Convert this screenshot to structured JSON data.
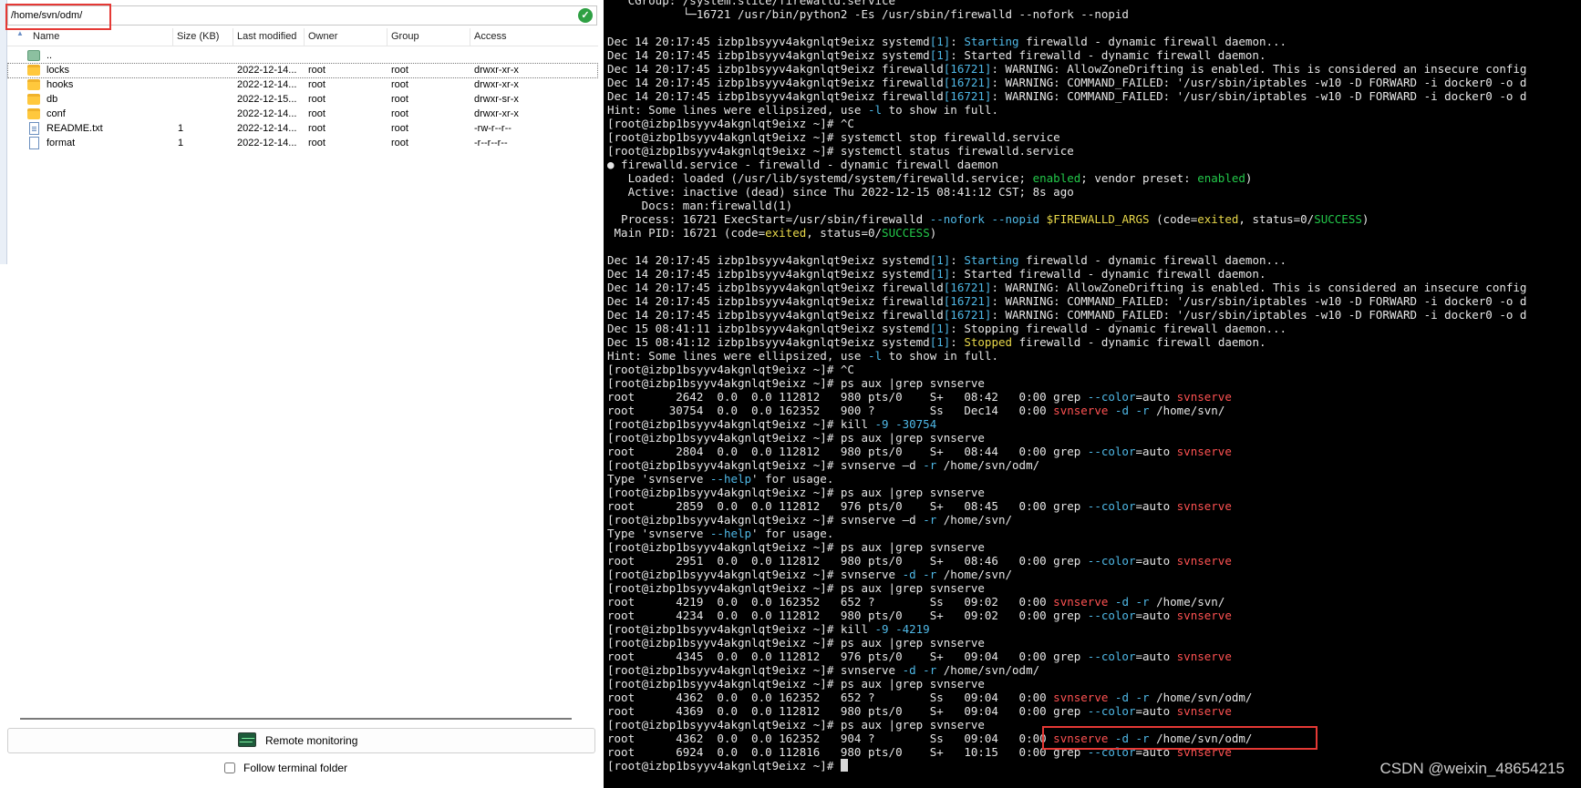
{
  "file_manager": {
    "path": "/home/svn/odm/",
    "columns": [
      "Name",
      "Size (KB)",
      "Last modified",
      "Owner",
      "Group",
      "Access"
    ],
    "rows": [
      {
        "icon": "parent-folder-icon",
        "name": "..",
        "size": "",
        "modified": "",
        "owner": "",
        "group": "",
        "access": ""
      },
      {
        "icon": "folder-icon",
        "name": "locks",
        "size": "",
        "modified": "2022-12-14...",
        "owner": "root",
        "group": "root",
        "access": "drwxr-xr-x"
      },
      {
        "icon": "folder-icon",
        "name": "hooks",
        "size": "",
        "modified": "2022-12-14...",
        "owner": "root",
        "group": "root",
        "access": "drwxr-xr-x"
      },
      {
        "icon": "folder-icon",
        "name": "db",
        "size": "",
        "modified": "2022-12-15...",
        "owner": "root",
        "group": "root",
        "access": "drwxr-sr-x"
      },
      {
        "icon": "folder-icon",
        "name": "conf",
        "size": "",
        "modified": "2022-12-14...",
        "owner": "root",
        "group": "root",
        "access": "drwxr-xr-x"
      },
      {
        "icon": "text-file-icon",
        "name": "README.txt",
        "size": "1",
        "modified": "2022-12-14...",
        "owner": "root",
        "group": "root",
        "access": "-rw-r--r--"
      },
      {
        "icon": "file-icon",
        "name": "format",
        "size": "1",
        "modified": "2022-12-14...",
        "owner": "root",
        "group": "root",
        "access": "-r--r--r--"
      }
    ],
    "remote_monitoring_label": "Remote monitoring",
    "follow_terminal_label": "Follow terminal folder"
  },
  "terminal": {
    "lines": [
      [
        [
          "   CGroup: /system.slice/firewalld.service",
          ""
        ]
      ],
      [
        [
          "           └─16721 /usr/bin/python2 -Es /usr/sbin/firewalld --nofork --nopid",
          ""
        ]
      ],
      [
        [
          "",
          ""
        ]
      ],
      [
        [
          "Dec 14 20:17:45 izbp1bsyyv4akgnlqt9eixz systemd",
          ""
        ],
        [
          "[1]",
          "blue"
        ],
        [
          ": ",
          ""
        ],
        [
          "Starting",
          "blue"
        ],
        [
          " firewalld - dynamic firewall daemon...",
          ""
        ]
      ],
      [
        [
          "Dec 14 20:17:45 izbp1bsyyv4akgnlqt9eixz systemd",
          ""
        ],
        [
          "[1]",
          "blue"
        ],
        [
          ": Started firewalld - dynamic firewall daemon.",
          ""
        ]
      ],
      [
        [
          "Dec 14 20:17:45 izbp1bsyyv4akgnlqt9eixz firewalld",
          ""
        ],
        [
          "[16721]",
          "blue"
        ],
        [
          ": WARNING: AllowZoneDrifting is enabled. This is considered an insecure config",
          ""
        ]
      ],
      [
        [
          "Dec 14 20:17:45 izbp1bsyyv4akgnlqt9eixz firewalld",
          ""
        ],
        [
          "[16721]",
          "blue"
        ],
        [
          ": WARNING: COMMAND_FAILED: '/usr/sbin/iptables -w10 -D FORWARD -i docker0 -o d",
          ""
        ]
      ],
      [
        [
          "Dec 14 20:17:45 izbp1bsyyv4akgnlqt9eixz firewalld",
          ""
        ],
        [
          "[16721]",
          "blue"
        ],
        [
          ": WARNING: COMMAND_FAILED: '/usr/sbin/iptables -w10 -D FORWARD -i docker0 -o d",
          ""
        ]
      ],
      [
        [
          "Hint: Some lines were ellipsized, use ",
          ""
        ],
        [
          "-l",
          "blue"
        ],
        [
          " to show in full.",
          ""
        ]
      ],
      [
        [
          "[root@izbp1bsyyv4akgnlqt9eixz ~]# ^C",
          ""
        ]
      ],
      [
        [
          "[root@izbp1bsyyv4akgnlqt9eixz ~]# systemctl stop firewalld.service",
          ""
        ]
      ],
      [
        [
          "[root@izbp1bsyyv4akgnlqt9eixz ~]# systemctl status firewalld.service",
          ""
        ]
      ],
      [
        [
          "● firewalld.service - firewalld - dynamic firewall daemon",
          ""
        ]
      ],
      [
        [
          "   Loaded: loaded (/usr/lib/systemd/system/firewalld.service; ",
          ""
        ],
        [
          "enabled",
          "green"
        ],
        [
          "; vendor preset: ",
          ""
        ],
        [
          "enabled",
          "green"
        ],
        [
          ")",
          ""
        ]
      ],
      [
        [
          "   Active: inactive (dead) since Thu 2022-12-15 08:41:12 CST; 8s ago",
          ""
        ]
      ],
      [
        [
          "     Docs: man:firewalld(1)",
          ""
        ]
      ],
      [
        [
          "  Process: 16721 ExecStart=/usr/sbin/firewalld ",
          ""
        ],
        [
          "--nofork --nopid",
          "blue"
        ],
        [
          " ",
          ""
        ],
        [
          "$FIREWALLD_ARGS",
          "yellow"
        ],
        [
          " (code=",
          ""
        ],
        [
          "exited",
          "yellow"
        ],
        [
          ", status=0/",
          ""
        ],
        [
          "SUCCESS",
          "green"
        ],
        [
          ")",
          ""
        ]
      ],
      [
        [
          " Main PID: 16721 (code=",
          ""
        ],
        [
          "exited",
          "yellow"
        ],
        [
          ", status=0/",
          ""
        ],
        [
          "SUCCESS",
          "green"
        ],
        [
          ")",
          ""
        ]
      ],
      [
        [
          "",
          ""
        ]
      ],
      [
        [
          "Dec 14 20:17:45 izbp1bsyyv4akgnlqt9eixz systemd",
          ""
        ],
        [
          "[1]",
          "blue"
        ],
        [
          ": ",
          ""
        ],
        [
          "Starting",
          "blue"
        ],
        [
          " firewalld - dynamic firewall daemon...",
          ""
        ]
      ],
      [
        [
          "Dec 14 20:17:45 izbp1bsyyv4akgnlqt9eixz systemd",
          ""
        ],
        [
          "[1]",
          "blue"
        ],
        [
          ": Started firewalld - dynamic firewall daemon.",
          ""
        ]
      ],
      [
        [
          "Dec 14 20:17:45 izbp1bsyyv4akgnlqt9eixz firewalld",
          ""
        ],
        [
          "[16721]",
          "blue"
        ],
        [
          ": WARNING: AllowZoneDrifting is enabled. This is considered an insecure config",
          ""
        ]
      ],
      [
        [
          "Dec 14 20:17:45 izbp1bsyyv4akgnlqt9eixz firewalld",
          ""
        ],
        [
          "[16721]",
          "blue"
        ],
        [
          ": WARNING: COMMAND_FAILED: '/usr/sbin/iptables -w10 -D FORWARD -i docker0 -o d",
          ""
        ]
      ],
      [
        [
          "Dec 14 20:17:45 izbp1bsyyv4akgnlqt9eixz firewalld",
          ""
        ],
        [
          "[16721]",
          "blue"
        ],
        [
          ": WARNING: COMMAND_FAILED: '/usr/sbin/iptables -w10 -D FORWARD -i docker0 -o d",
          ""
        ]
      ],
      [
        [
          "Dec 15 08:41:11 izbp1bsyyv4akgnlqt9eixz systemd",
          ""
        ],
        [
          "[1]",
          "blue"
        ],
        [
          ": Stopping firewalld - dynamic firewall daemon...",
          ""
        ]
      ],
      [
        [
          "Dec 15 08:41:12 izbp1bsyyv4akgnlqt9eixz systemd",
          ""
        ],
        [
          "[1]",
          "blue"
        ],
        [
          ": ",
          ""
        ],
        [
          "Stopped",
          "yellow"
        ],
        [
          " firewalld - dynamic firewall daemon.",
          ""
        ]
      ],
      [
        [
          "Hint: Some lines were ellipsized, use ",
          ""
        ],
        [
          "-l",
          "blue"
        ],
        [
          " to show in full.",
          ""
        ]
      ],
      [
        [
          "[root@izbp1bsyyv4akgnlqt9eixz ~]# ^C",
          ""
        ]
      ],
      [
        [
          "[root@izbp1bsyyv4akgnlqt9eixz ~]# ps aux |grep svnserve",
          ""
        ]
      ],
      [
        [
          "root      2642  0.0  0.0 112812   980 pts/0    S+   08:42   0:00 grep ",
          ""
        ],
        [
          "--color",
          "blue"
        ],
        [
          "=auto ",
          ""
        ],
        [
          "svnserve",
          "red"
        ]
      ],
      [
        [
          "root     30754  0.0  0.0 162352   900 ?        Ss   Dec14   0:00 ",
          ""
        ],
        [
          "svnserve",
          "red"
        ],
        [
          " ",
          ""
        ],
        [
          "-d -r",
          "blue"
        ],
        [
          " /home/svn/",
          ""
        ]
      ],
      [
        [
          "[root@izbp1bsyyv4akgnlqt9eixz ~]# kill ",
          ""
        ],
        [
          "-9 -30754",
          "blue"
        ]
      ],
      [
        [
          "[root@izbp1bsyyv4akgnlqt9eixz ~]# ps aux |grep svnserve",
          ""
        ]
      ],
      [
        [
          "root      2804  0.0  0.0 112812   980 pts/0    S+   08:44   0:00 grep ",
          ""
        ],
        [
          "--color",
          "blue"
        ],
        [
          "=auto ",
          ""
        ],
        [
          "svnserve",
          "red"
        ]
      ],
      [
        [
          "[root@izbp1bsyyv4akgnlqt9eixz ~]# svnserve –d ",
          ""
        ],
        [
          "-r",
          "blue"
        ],
        [
          " /home/svn/odm/",
          ""
        ]
      ],
      [
        [
          "Type 'svnserve ",
          ""
        ],
        [
          "--help",
          "blue"
        ],
        [
          "' for usage.",
          ""
        ]
      ],
      [
        [
          "[root@izbp1bsyyv4akgnlqt9eixz ~]# ps aux |grep svnserve",
          ""
        ]
      ],
      [
        [
          "root      2859  0.0  0.0 112812   976 pts/0    S+   08:45   0:00 grep ",
          ""
        ],
        [
          "--color",
          "blue"
        ],
        [
          "=auto ",
          ""
        ],
        [
          "svnserve",
          "red"
        ]
      ],
      [
        [
          "[root@izbp1bsyyv4akgnlqt9eixz ~]# svnserve –d ",
          ""
        ],
        [
          "-r",
          "blue"
        ],
        [
          " /home/svn/",
          ""
        ]
      ],
      [
        [
          "Type 'svnserve ",
          ""
        ],
        [
          "--help",
          "blue"
        ],
        [
          "' for usage.",
          ""
        ]
      ],
      [
        [
          "[root@izbp1bsyyv4akgnlqt9eixz ~]# ps aux |grep svnserve",
          ""
        ]
      ],
      [
        [
          "root      2951  0.0  0.0 112812   980 pts/0    S+   08:46   0:00 grep ",
          ""
        ],
        [
          "--color",
          "blue"
        ],
        [
          "=auto ",
          ""
        ],
        [
          "svnserve",
          "red"
        ]
      ],
      [
        [
          "[root@izbp1bsyyv4akgnlqt9eixz ~]# svnserve ",
          ""
        ],
        [
          "-d -r",
          "blue"
        ],
        [
          " /home/svn/",
          ""
        ]
      ],
      [
        [
          "[root@izbp1bsyyv4akgnlqt9eixz ~]# ps aux |grep svnserve",
          ""
        ]
      ],
      [
        [
          "root      4219  0.0  0.0 162352   652 ?        Ss   09:02   0:00 ",
          ""
        ],
        [
          "svnserve",
          "red"
        ],
        [
          " ",
          ""
        ],
        [
          "-d -r",
          "blue"
        ],
        [
          " /home/svn/",
          ""
        ]
      ],
      [
        [
          "root      4234  0.0  0.0 112812   980 pts/0    S+   09:02   0:00 grep ",
          ""
        ],
        [
          "--color",
          "blue"
        ],
        [
          "=auto ",
          ""
        ],
        [
          "svnserve",
          "red"
        ]
      ],
      [
        [
          "[root@izbp1bsyyv4akgnlqt9eixz ~]# kill ",
          ""
        ],
        [
          "-9 -4219",
          "blue"
        ]
      ],
      [
        [
          "[root@izbp1bsyyv4akgnlqt9eixz ~]# ps aux |grep svnserve",
          ""
        ]
      ],
      [
        [
          "root      4345  0.0  0.0 112812   976 pts/0    S+   09:04   0:00 grep ",
          ""
        ],
        [
          "--color",
          "blue"
        ],
        [
          "=auto ",
          ""
        ],
        [
          "svnserve",
          "red"
        ]
      ],
      [
        [
          "[root@izbp1bsyyv4akgnlqt9eixz ~]# svnserve ",
          ""
        ],
        [
          "-d -r",
          "blue"
        ],
        [
          " /home/svn/odm/",
          ""
        ]
      ],
      [
        [
          "[root@izbp1bsyyv4akgnlqt9eixz ~]# ps aux |grep svnserve",
          ""
        ]
      ],
      [
        [
          "root      4362  0.0  0.0 162352   652 ?        Ss   09:04   0:00 ",
          ""
        ],
        [
          "svnserve",
          "red"
        ],
        [
          " ",
          ""
        ],
        [
          "-d -r",
          "blue"
        ],
        [
          " /home/svn/odm/",
          ""
        ]
      ],
      [
        [
          "root      4369  0.0  0.0 112812   980 pts/0    S+   09:04   0:00 grep ",
          ""
        ],
        [
          "--color",
          "blue"
        ],
        [
          "=auto ",
          ""
        ],
        [
          "svnserve",
          "red"
        ]
      ],
      [
        [
          "[root@izbp1bsyyv4akgnlqt9eixz ~]# ps aux |grep svnserve",
          ""
        ]
      ],
      [
        [
          "root      4362  0.0  0.0 162352   904 ?        Ss   09:04   0:00 ",
          ""
        ],
        [
          "svnserve",
          "red"
        ],
        [
          " ",
          ""
        ],
        [
          "-d -r",
          "blue"
        ],
        [
          " /home/svn/odm/",
          ""
        ]
      ],
      [
        [
          "root      6924  0.0  0.0 112816   980 pts/0    S+   10:15   0:00 grep ",
          ""
        ],
        [
          "--color",
          "blue"
        ],
        [
          "=auto ",
          ""
        ],
        [
          "svnserve",
          "red"
        ]
      ],
      [
        [
          "[root@izbp1bsyyv4akgnlqt9eixz ~]# ",
          ""
        ]
      ]
    ]
  },
  "watermark": "CSDN @weixin_48654215",
  "colors": {
    "terminal_bg": "#000000",
    "terminal_fg": "#e6e6e6",
    "accent_blue": "#4fb8e6",
    "accent_green": "#23c84a",
    "accent_yellow": "#e8d84a",
    "accent_red": "#ff5252",
    "highlight_box": "#e53935"
  }
}
